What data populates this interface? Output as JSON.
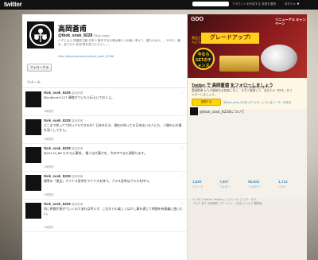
{
  "topbar": {
    "logo": "twitter",
    "note": "アカウントを作成する 言語を選択",
    "login": "ログイン"
  },
  "profile": {
    "name": "高岡蒼甫",
    "handle": "@tkok_sosk_8228",
    "location": "Tokyo,Japan",
    "bio": "ハグとよ人 所属設立館 日本人 集中するの事は事に入れ無く考えて、僕らの大人、、ややけ、最も、全ての人 状況 等を見さらで少し...。",
    "link": "http://blog.leadover.jp/tkok_sosk_8228/",
    "follow_button": "フォローする",
    "tweets_tab": "ツイート"
  },
  "tweets": [
    {
      "user": "tkok_sosk_8228",
      "name": "高岡蒼甫",
      "text": "@yutikum1127 連絡がついたら伝えいておくよ。",
      "time": "1時間前"
    },
    {
      "user": "tkok_sosk_8228",
      "name": "高岡蒼甫",
      "text": "どこまで知ってて知ってもできるの？日本を行き、現在の知ってる日本はいる人にも、人間の心の事を深くしてから。",
      "time": "1時間前"
    },
    {
      "user": "tkok_sosk_8228",
      "name": "高岡蒼甫",
      "text": "@s3110_66 もちろん事覚。 僕人は大事さを、今の中でまた頑張ります。",
      "time": "1時間前"
    },
    {
      "user": "tkok_sosk_8228",
      "name": "高岡蒼甫",
      "text": "僕等の「過去」マイナス思考をマイナスを持つ。プラス思考はプラスを持つ。",
      "time": "1時間前"
    },
    {
      "user": "tkok_sosk_8228",
      "name": "高岡蒼甫",
      "text": "同じ時間が過ぎていくのであれば考えず、これからも楽しくは少し事を通じて時間を有意義に使いたい。",
      "time": "1時間前"
    }
  ],
  "banner": {
    "brand": "GDO",
    "renewal": "リニューアル キャンペーン",
    "prefix": "賞品どんどん",
    "headline": "グレードアップ!",
    "circle": "今なら GETのチャンス"
  },
  "promo": {
    "title": "Twitter で 高岡蒼甫 をフォローしましょう",
    "desc": "高岡蒼甫 からの更新をお見逃しなく。今すぐ登録して、あなたの「好き」をフォローしましょう。",
    "follow_button": "登録する",
    "text2": "高岡蒼甫 がどのように Twitter を使っているか興味がありますか？",
    "embed_button": "登録する",
    "embed_link": "@tkok_sosk_8228 がフォローしているユーザーを見る"
  },
  "about": {
    "title": "@tkok_sosk_8228について"
  },
  "stats": [
    {
      "num": "1,820",
      "label": "ツイート"
    },
    {
      "num": "7,607",
      "label": "フォロー"
    },
    {
      "num": "96,823",
      "label": "フォロワー"
    },
    {
      "num": "1,714",
      "label": "リスト"
    }
  ],
  "footer": {
    "line1": "© 2011 Twitter Twitterについて ヘルプ ステータス",
    "line2": "ブログ 求人 利用規約 プライバシー 広告 ビジネス 開発者"
  }
}
